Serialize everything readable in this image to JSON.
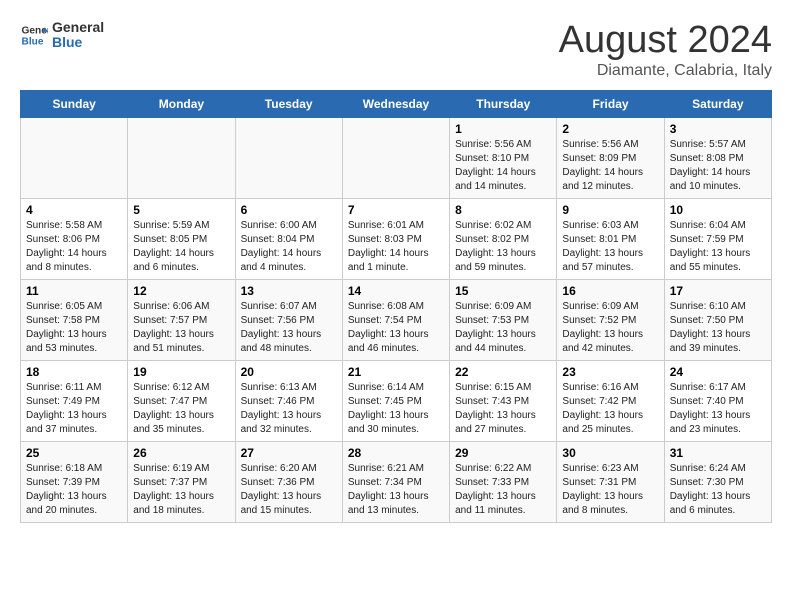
{
  "logo": {
    "line1": "General",
    "line2": "Blue"
  },
  "title": "August 2024",
  "subtitle": "Diamante, Calabria, Italy",
  "weekdays": [
    "Sunday",
    "Monday",
    "Tuesday",
    "Wednesday",
    "Thursday",
    "Friday",
    "Saturday"
  ],
  "weeks": [
    [
      {
        "day": "",
        "info": ""
      },
      {
        "day": "",
        "info": ""
      },
      {
        "day": "",
        "info": ""
      },
      {
        "day": "",
        "info": ""
      },
      {
        "day": "1",
        "info": "Sunrise: 5:56 AM\nSunset: 8:10 PM\nDaylight: 14 hours\nand 14 minutes."
      },
      {
        "day": "2",
        "info": "Sunrise: 5:56 AM\nSunset: 8:09 PM\nDaylight: 14 hours\nand 12 minutes."
      },
      {
        "day": "3",
        "info": "Sunrise: 5:57 AM\nSunset: 8:08 PM\nDaylight: 14 hours\nand 10 minutes."
      }
    ],
    [
      {
        "day": "4",
        "info": "Sunrise: 5:58 AM\nSunset: 8:06 PM\nDaylight: 14 hours\nand 8 minutes."
      },
      {
        "day": "5",
        "info": "Sunrise: 5:59 AM\nSunset: 8:05 PM\nDaylight: 14 hours\nand 6 minutes."
      },
      {
        "day": "6",
        "info": "Sunrise: 6:00 AM\nSunset: 8:04 PM\nDaylight: 14 hours\nand 4 minutes."
      },
      {
        "day": "7",
        "info": "Sunrise: 6:01 AM\nSunset: 8:03 PM\nDaylight: 14 hours\nand 1 minute."
      },
      {
        "day": "8",
        "info": "Sunrise: 6:02 AM\nSunset: 8:02 PM\nDaylight: 13 hours\nand 59 minutes."
      },
      {
        "day": "9",
        "info": "Sunrise: 6:03 AM\nSunset: 8:01 PM\nDaylight: 13 hours\nand 57 minutes."
      },
      {
        "day": "10",
        "info": "Sunrise: 6:04 AM\nSunset: 7:59 PM\nDaylight: 13 hours\nand 55 minutes."
      }
    ],
    [
      {
        "day": "11",
        "info": "Sunrise: 6:05 AM\nSunset: 7:58 PM\nDaylight: 13 hours\nand 53 minutes."
      },
      {
        "day": "12",
        "info": "Sunrise: 6:06 AM\nSunset: 7:57 PM\nDaylight: 13 hours\nand 51 minutes."
      },
      {
        "day": "13",
        "info": "Sunrise: 6:07 AM\nSunset: 7:56 PM\nDaylight: 13 hours\nand 48 minutes."
      },
      {
        "day": "14",
        "info": "Sunrise: 6:08 AM\nSunset: 7:54 PM\nDaylight: 13 hours\nand 46 minutes."
      },
      {
        "day": "15",
        "info": "Sunrise: 6:09 AM\nSunset: 7:53 PM\nDaylight: 13 hours\nand 44 minutes."
      },
      {
        "day": "16",
        "info": "Sunrise: 6:09 AM\nSunset: 7:52 PM\nDaylight: 13 hours\nand 42 minutes."
      },
      {
        "day": "17",
        "info": "Sunrise: 6:10 AM\nSunset: 7:50 PM\nDaylight: 13 hours\nand 39 minutes."
      }
    ],
    [
      {
        "day": "18",
        "info": "Sunrise: 6:11 AM\nSunset: 7:49 PM\nDaylight: 13 hours\nand 37 minutes."
      },
      {
        "day": "19",
        "info": "Sunrise: 6:12 AM\nSunset: 7:47 PM\nDaylight: 13 hours\nand 35 minutes."
      },
      {
        "day": "20",
        "info": "Sunrise: 6:13 AM\nSunset: 7:46 PM\nDaylight: 13 hours\nand 32 minutes."
      },
      {
        "day": "21",
        "info": "Sunrise: 6:14 AM\nSunset: 7:45 PM\nDaylight: 13 hours\nand 30 minutes."
      },
      {
        "day": "22",
        "info": "Sunrise: 6:15 AM\nSunset: 7:43 PM\nDaylight: 13 hours\nand 27 minutes."
      },
      {
        "day": "23",
        "info": "Sunrise: 6:16 AM\nSunset: 7:42 PM\nDaylight: 13 hours\nand 25 minutes."
      },
      {
        "day": "24",
        "info": "Sunrise: 6:17 AM\nSunset: 7:40 PM\nDaylight: 13 hours\nand 23 minutes."
      }
    ],
    [
      {
        "day": "25",
        "info": "Sunrise: 6:18 AM\nSunset: 7:39 PM\nDaylight: 13 hours\nand 20 minutes."
      },
      {
        "day": "26",
        "info": "Sunrise: 6:19 AM\nSunset: 7:37 PM\nDaylight: 13 hours\nand 18 minutes."
      },
      {
        "day": "27",
        "info": "Sunrise: 6:20 AM\nSunset: 7:36 PM\nDaylight: 13 hours\nand 15 minutes."
      },
      {
        "day": "28",
        "info": "Sunrise: 6:21 AM\nSunset: 7:34 PM\nDaylight: 13 hours\nand 13 minutes."
      },
      {
        "day": "29",
        "info": "Sunrise: 6:22 AM\nSunset: 7:33 PM\nDaylight: 13 hours\nand 11 minutes."
      },
      {
        "day": "30",
        "info": "Sunrise: 6:23 AM\nSunset: 7:31 PM\nDaylight: 13 hours\nand 8 minutes."
      },
      {
        "day": "31",
        "info": "Sunrise: 6:24 AM\nSunset: 7:30 PM\nDaylight: 13 hours\nand 6 minutes."
      }
    ]
  ]
}
